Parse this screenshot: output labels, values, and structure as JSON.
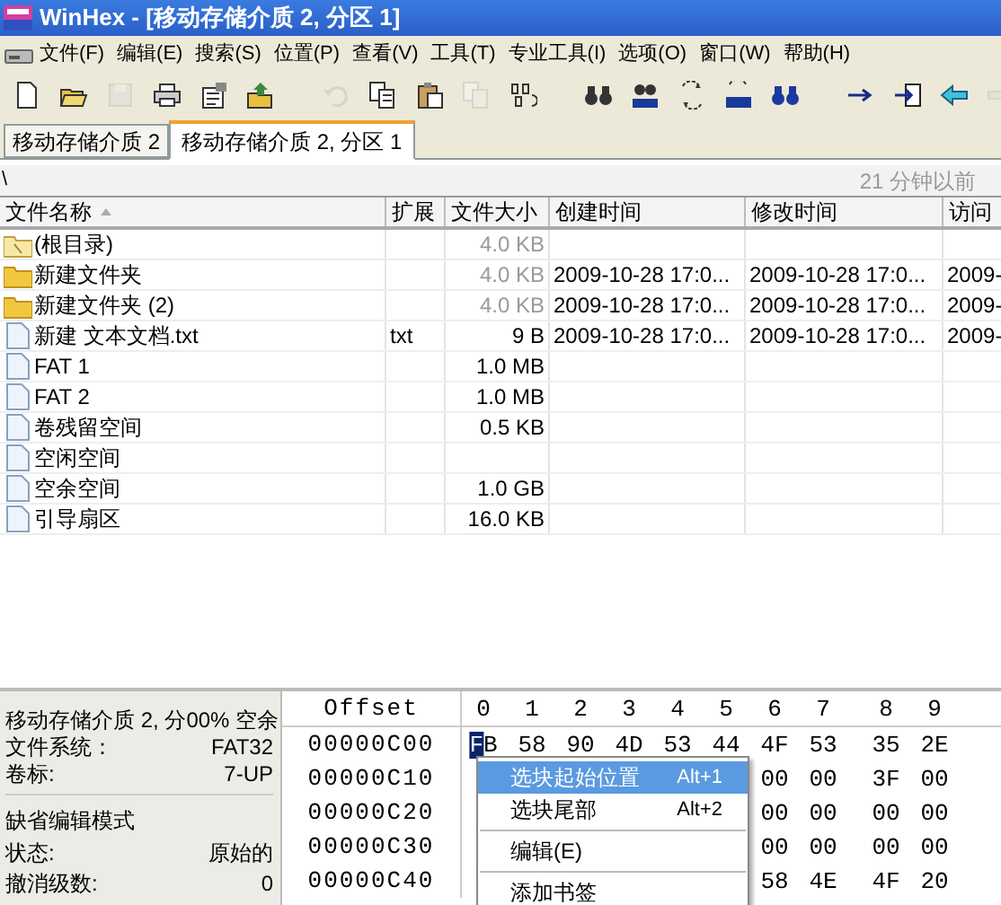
{
  "window": {
    "title": "WinHex - [移动存储介质 2, 分区 1]"
  },
  "menu": [
    "文件(F)",
    "编辑(E)",
    "搜索(S)",
    "位置(P)",
    "查看(V)",
    "工具(T)",
    "专业工具(I)",
    "选项(O)",
    "窗口(W)",
    "帮助(H)"
  ],
  "toolbar": [
    [
      {
        "disabled": false
      },
      {
        "disabled": false
      },
      {
        "disabled": true
      },
      {
        "disabled": false
      },
      {
        "disabled": false
      },
      {
        "disabled": false
      }
    ],
    [
      {
        "disabled": true
      },
      {
        "disabled": false
      },
      {
        "disabled": false
      },
      {
        "disabled": true
      },
      {
        "disabled": false
      }
    ],
    [
      {
        "disabled": false
      },
      {
        "disabled": false
      },
      {
        "disabled": false
      },
      {
        "disabled": false
      },
      {
        "disabled": false
      }
    ],
    [
      {
        "disabled": false
      },
      {
        "disabled": false
      },
      {
        "disabled": false
      },
      {
        "disabled": true
      }
    ]
  ],
  "tabs": [
    {
      "label": "移动存储介质 2",
      "selected": false
    },
    {
      "label": "移动存储介质 2, 分区 1",
      "selected": true
    }
  ],
  "path_bar": {
    "path": "\\",
    "age": "21 分钟以前"
  },
  "table": {
    "columns": [
      "文件名称",
      "扩展",
      "文件大小",
      "创建时间",
      "修改时间",
      "访问"
    ],
    "rows": [
      {
        "kind": "root",
        "name": "(根目录)",
        "size": "4.0 KB",
        "size_dimmed": true
      },
      {
        "kind": "folder",
        "name": "新建文件夹",
        "size": "4.0 KB",
        "size_dimmed": true,
        "created": "2009-10-28  17:0...",
        "modified": "2009-10-28  17:0...",
        "accessed": "2009-"
      },
      {
        "kind": "folder",
        "name": "新建文件夹 (2)",
        "size": "4.0 KB",
        "size_dimmed": true,
        "created": "2009-10-28  17:0...",
        "modified": "2009-10-28  17:0...",
        "accessed": "2009-"
      },
      {
        "kind": "file",
        "name": "新建 文本文档.txt",
        "ext": "txt",
        "size": "9 B",
        "size_dimmed": false,
        "created": "2009-10-28  17:0...",
        "modified": "2009-10-28  17:0...",
        "accessed": "2009-"
      },
      {
        "kind": "file",
        "name": "FAT 1",
        "size": "1.0 MB",
        "size_dimmed": false
      },
      {
        "kind": "file",
        "name": "FAT 2",
        "size": "1.0 MB",
        "size_dimmed": false
      },
      {
        "kind": "file",
        "name": "卷残留空间",
        "size": "0.5 KB",
        "size_dimmed": false
      },
      {
        "kind": "file",
        "name": "空闲空间"
      },
      {
        "kind": "file",
        "name": "空余空间",
        "size": "1.0 GB",
        "size_dimmed": false
      },
      {
        "kind": "file",
        "name": "引导扇区",
        "size": "16.0 KB",
        "size_dimmed": false
      }
    ]
  },
  "info_panel": [
    [
      {
        "label": "移动存储介质 2, 分",
        "value": "00% 空余"
      },
      {
        "label": "文件系统：",
        "value": "FAT32"
      },
      {
        "label": "卷标:",
        "value": "7-UP"
      }
    ],
    [
      {
        "label": "缺省编辑模式"
      },
      {
        "label": "状态:",
        "value": "原始的"
      },
      {
        "label": "撤消级数:",
        "value": "0"
      }
    ]
  ],
  "hex": {
    "offset_header": "Offset",
    "column_headers": [
      "0",
      "1",
      "2",
      "3",
      "4",
      "5",
      "6",
      "7",
      "8",
      "9"
    ],
    "cursor": true,
    "rows": [
      {
        "offset": "00000C00",
        "bytes": [
          "FB",
          "58",
          "90",
          "4D",
          "53",
          "44",
          "4F",
          "53",
          "35",
          "2E"
        ]
      },
      {
        "offset": "00000C10",
        "bytes": [
          "00",
          "00",
          "3F",
          "00"
        ]
      },
      {
        "offset": "00000C20",
        "bytes": [
          "00",
          "00",
          "00",
          "00"
        ]
      },
      {
        "offset": "00000C30",
        "bytes": [
          "00",
          "00",
          "00",
          "00"
        ]
      },
      {
        "offset": "00000C40",
        "bytes": [
          "58",
          "4E",
          "4F",
          "20"
        ]
      }
    ]
  },
  "context_menu": [
    {
      "kind": "item",
      "label": "选块起始位置",
      "shortcut": "Alt+1",
      "selected": true
    },
    {
      "kind": "item",
      "label": "选块尾部",
      "shortcut": "Alt+2",
      "selected": false
    },
    {
      "kind": "separator"
    },
    {
      "kind": "item",
      "label": "编辑(E)",
      "selected": false
    },
    {
      "kind": "separator"
    },
    {
      "kind": "item",
      "label": "添加书签",
      "selected": false
    }
  ]
}
